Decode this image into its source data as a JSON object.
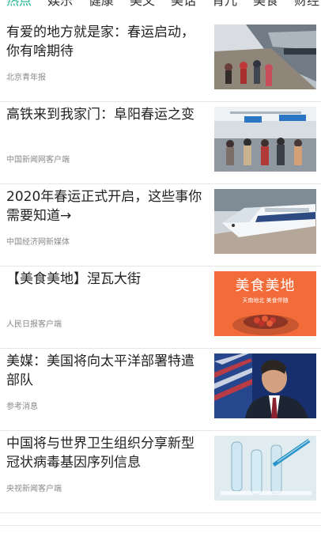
{
  "tabs": [
    "热点",
    "娱乐",
    "健康",
    "美文",
    "美话",
    "育儿",
    "美食",
    "财经"
  ],
  "colors": {
    "active_tab": "#14b48a",
    "title": "#222222",
    "source": "#8a8a8a",
    "divider": "#e6e6e6"
  },
  "news": [
    {
      "title": "有爱的地方就是家：春运启动，你有啥期待",
      "source": "北京青年报",
      "image": "railway-platform-photo"
    },
    {
      "title": "高铁来到我家门：阜阳春运之变",
      "source": "中国新闻网客户端",
      "image": "station-hall-photo"
    },
    {
      "title": "2020年春运正式开启，这些事你需要知道→",
      "source": "中国经济网新媒体",
      "image": "high-speed-train-photo"
    },
    {
      "title": "【美食美地】涅瓦大街",
      "source": "人民日报客户端",
      "image": "food-graphic",
      "thumb_title": "美食美地",
      "thumb_subtitle": "天南地北 美食伴随"
    },
    {
      "title": "美媒：美国将向太平洋部署特遣部队",
      "source": "参考消息",
      "image": "official-portrait-photo"
    },
    {
      "title": "中国将与世界卫生组织分享新型冠状病毒基因序列信息",
      "source": "央视新闻客户端",
      "image": "laboratory-photo"
    }
  ]
}
